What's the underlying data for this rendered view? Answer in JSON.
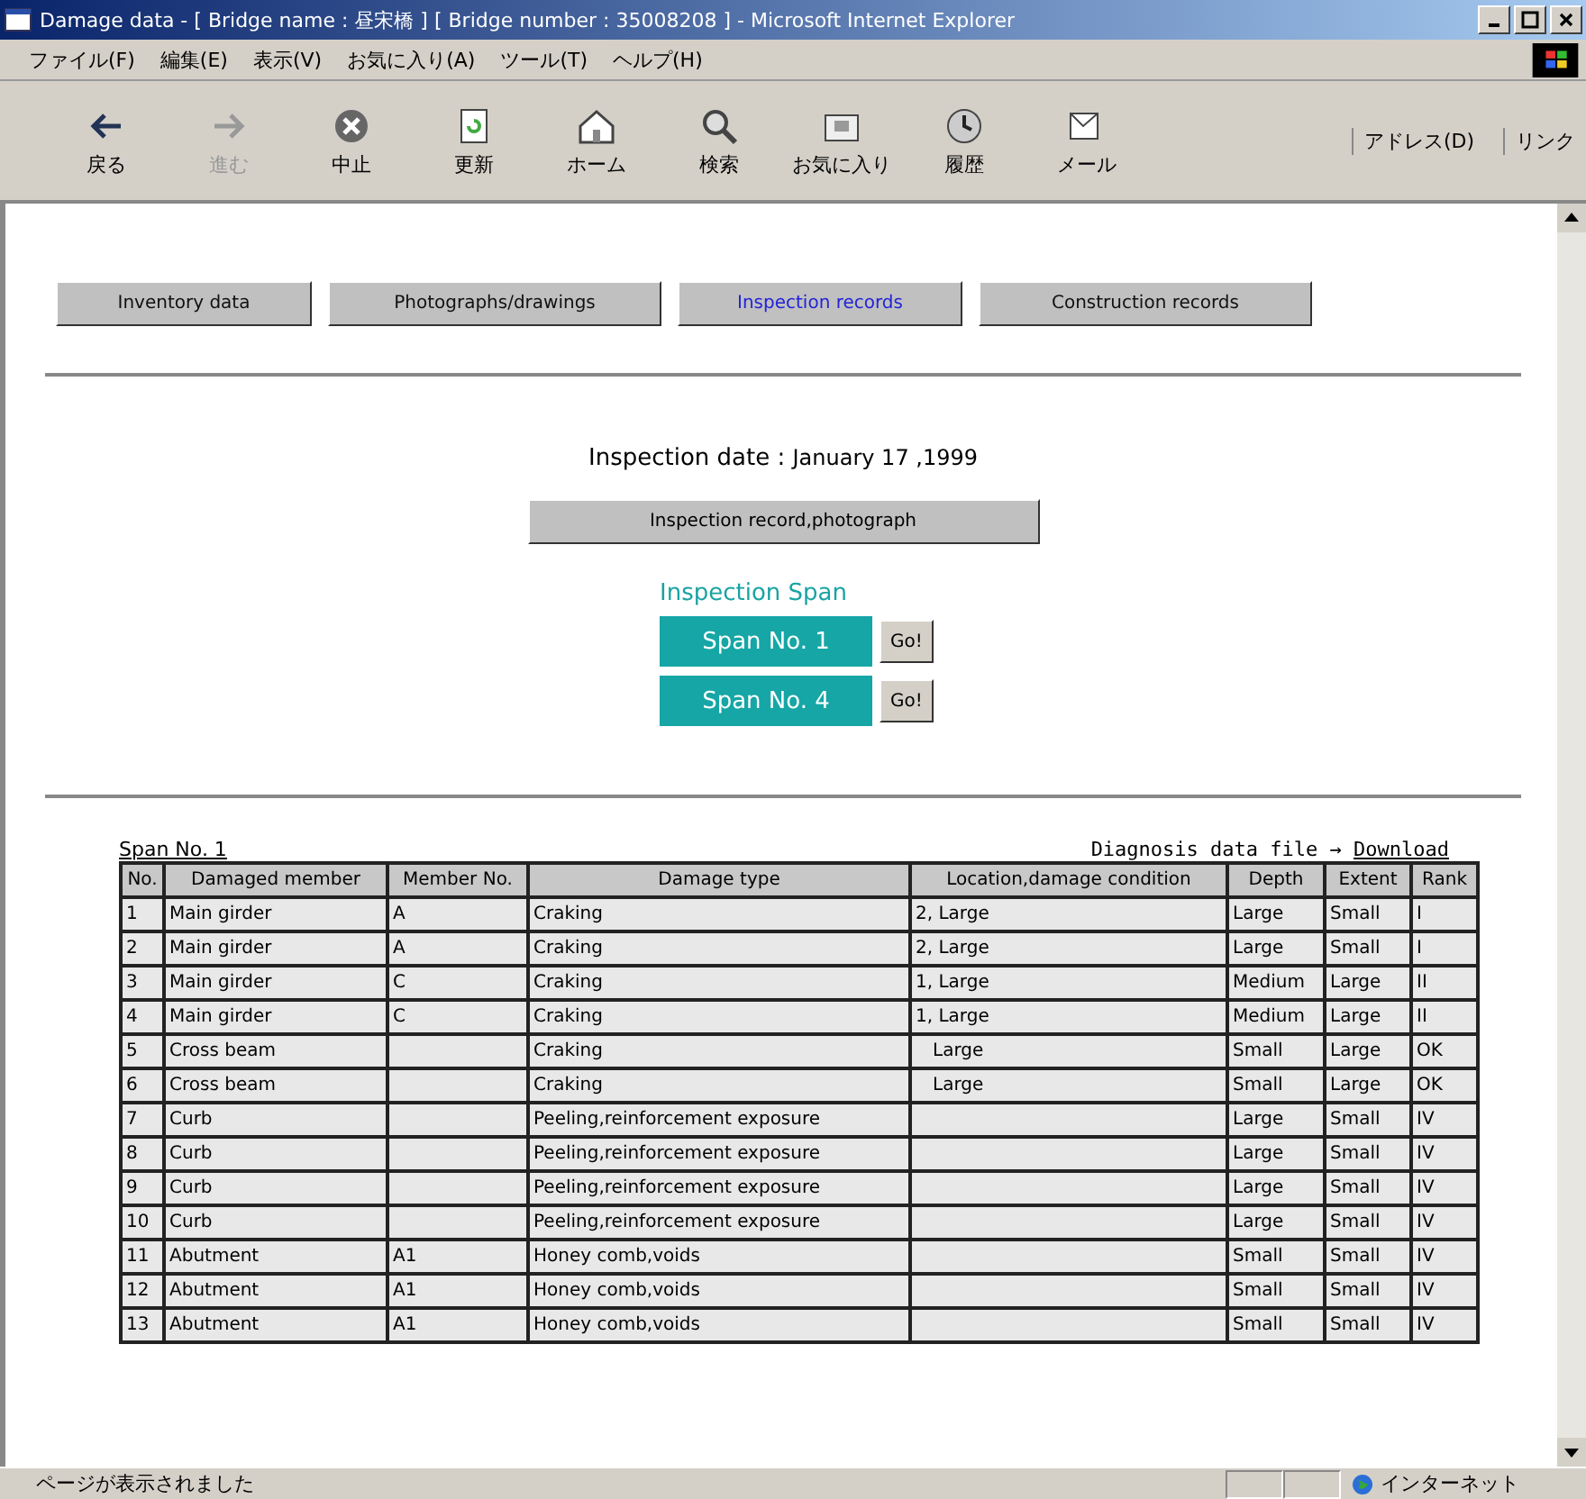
{
  "window": {
    "title": "Damage data - [ Bridge name : 昼宋橋 ] [ Bridge number : 35008208 ] - Microsoft Internet Explorer"
  },
  "menu": [
    "ファイル(F)",
    "編集(E)",
    "表示(V)",
    "お気に入り(A)",
    "ツール(T)",
    "ヘルプ(H)"
  ],
  "toolbar": [
    {
      "label": "戻る",
      "disabled": false
    },
    {
      "label": "進む",
      "disabled": true
    },
    {
      "label": "中止",
      "disabled": false
    },
    {
      "label": "更新",
      "disabled": false
    },
    {
      "label": "ホーム",
      "disabled": false
    },
    {
      "label": "検索",
      "disabled": false
    },
    {
      "label": "お気に入り",
      "disabled": false
    },
    {
      "label": "履歴",
      "disabled": false
    },
    {
      "label": "メール",
      "disabled": false
    }
  ],
  "address_label": "アドレス(D)",
  "links_label": "リンク",
  "tabs": [
    {
      "label": "Inventory data",
      "selected": false
    },
    {
      "label": "Photographs/drawings",
      "selected": false
    },
    {
      "label": "Inspection records",
      "selected": true
    },
    {
      "label": "Construction records",
      "selected": false
    }
  ],
  "inspection_date": {
    "label": "Inspection date :",
    "value": "January  17  ,1999"
  },
  "record_button": "Inspection record,photograph",
  "span_heading": "Inspection Span",
  "spans": [
    {
      "label": "Span No. 1",
      "go": "Go!"
    },
    {
      "label": "Span No. 4",
      "go": "Go!"
    }
  ],
  "span_title": "Span No. 1",
  "diagnosis": {
    "text": "Diagnosis data file →",
    "link": "Download"
  },
  "table": {
    "columns": [
      "No.",
      "Damaged member",
      "Member No.",
      "Damage type",
      "Location,damage condition",
      "Depth",
      "Extent",
      "Rank"
    ],
    "rows": [
      [
        "1",
        "Main girder",
        "A",
        "Craking",
        "2, Large",
        "Large",
        "Small",
        "I"
      ],
      [
        "2",
        "Main girder",
        "A",
        "Craking",
        "2, Large",
        "Large",
        "Small",
        "I"
      ],
      [
        "3",
        "Main girder",
        "C",
        "Craking",
        "1, Large",
        "Medium",
        "Large",
        "II"
      ],
      [
        "4",
        "Main girder",
        "C",
        "Craking",
        "1, Large",
        "Medium",
        "Large",
        "II"
      ],
      [
        "5",
        "Cross beam",
        "",
        "Craking",
        "   Large",
        "Small",
        "Large",
        "OK"
      ],
      [
        "6",
        "Cross beam",
        "",
        "Craking",
        "   Large",
        "Small",
        "Large",
        "OK"
      ],
      [
        "7",
        "Curb",
        "",
        "Peeling,reinforcement exposure",
        "",
        "Large",
        "Small",
        "IV"
      ],
      [
        "8",
        "Curb",
        "",
        "Peeling,reinforcement exposure",
        "",
        "Large",
        "Small",
        "IV"
      ],
      [
        "9",
        "Curb",
        "",
        "Peeling,reinforcement exposure",
        "",
        "Large",
        "Small",
        "IV"
      ],
      [
        "10",
        "Curb",
        "",
        "Peeling,reinforcement exposure",
        "",
        "Large",
        "Small",
        "IV"
      ],
      [
        "11",
        "Abutment",
        "A1",
        "Honey comb,voids",
        "",
        "Small",
        "Small",
        "IV"
      ],
      [
        "12",
        "Abutment",
        "A1",
        "Honey comb,voids",
        "",
        "Small",
        "Small",
        "IV"
      ],
      [
        "13",
        "Abutment",
        "A1",
        "Honey comb,voids",
        "",
        "Small",
        "Small",
        "IV"
      ]
    ]
  },
  "status_bar": {
    "text": "ページが表示されました",
    "zone": "インターネット"
  }
}
